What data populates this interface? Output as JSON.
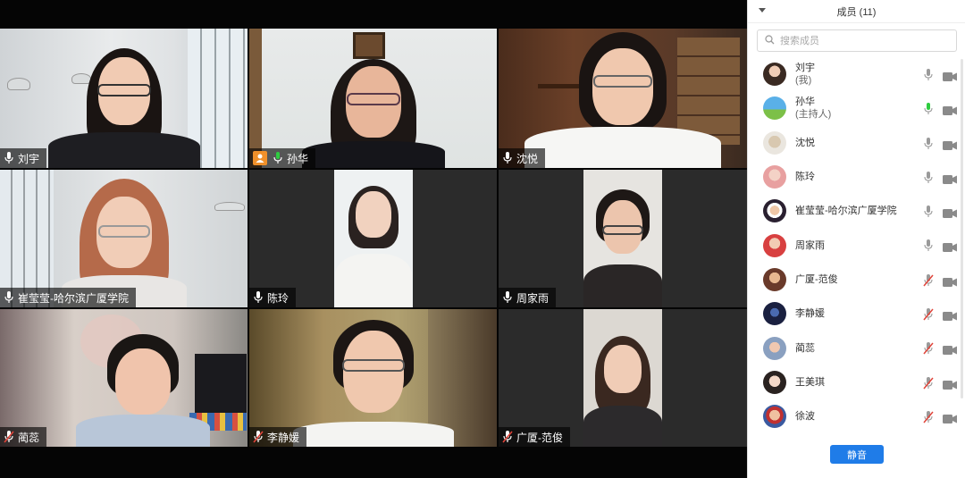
{
  "panel": {
    "title": "成员 (11)",
    "search": {
      "placeholder": "搜索成员",
      "value": ""
    },
    "mute_all_label": "静音",
    "members": [
      {
        "name": "刘宇",
        "sub": "(我)",
        "mic": "on",
        "avatar_icon": "user-photo-avatar-icon"
      },
      {
        "name": "孙华",
        "sub": "(主持人)",
        "mic": "speaking",
        "avatar_icon": "user-photo-avatar-icon"
      },
      {
        "name": "沈悦",
        "sub": "",
        "mic": "on",
        "avatar_icon": "user-photo-avatar-icon"
      },
      {
        "name": "陈玲",
        "sub": "",
        "mic": "on",
        "avatar_icon": "user-photo-avatar-icon"
      },
      {
        "name": "崔莹莹-哈尔滨广厦学院",
        "sub": "",
        "mic": "on",
        "avatar_icon": "user-photo-avatar-icon"
      },
      {
        "name": "周家雨",
        "sub": "",
        "mic": "on",
        "avatar_icon": "user-photo-avatar-icon"
      },
      {
        "name": "广厦-范俊",
        "sub": "",
        "mic": "muted",
        "avatar_icon": "user-photo-avatar-icon"
      },
      {
        "name": "李静媛",
        "sub": "",
        "mic": "muted",
        "avatar_icon": "user-photo-avatar-icon"
      },
      {
        "name": "蔺蕊",
        "sub": "",
        "mic": "muted",
        "avatar_icon": "user-photo-avatar-icon"
      },
      {
        "name": "王美琪",
        "sub": "",
        "mic": "muted",
        "avatar_icon": "user-photo-avatar-icon"
      },
      {
        "name": "徐波",
        "sub": "",
        "mic": "muted",
        "avatar_icon": "user-photo-avatar-icon"
      }
    ]
  },
  "tiles": [
    {
      "name": "刘宇",
      "mic": "on",
      "host": false,
      "active": false
    },
    {
      "name": "孙华",
      "mic": "speaking",
      "host": true,
      "active": true
    },
    {
      "name": "沈悦",
      "mic": "on",
      "host": false,
      "active": false
    },
    {
      "name": "崔莹莹-哈尔滨广厦学院",
      "mic": "on",
      "host": false,
      "active": false
    },
    {
      "name": "陈玲",
      "mic": "on",
      "host": false,
      "active": false
    },
    {
      "name": "周家雨",
      "mic": "on",
      "host": false,
      "active": false
    },
    {
      "name": "蔺蕊",
      "mic": "muted",
      "host": false,
      "active": false
    },
    {
      "name": "李静媛",
      "mic": "muted",
      "host": false,
      "active": false
    },
    {
      "name": "广厦-范俊",
      "mic": "muted",
      "host": false,
      "active": false
    }
  ],
  "colors": {
    "accent_blue": "#1f7ce8",
    "speaking_green": "#2ecc40",
    "muted_red": "#e0443a",
    "host_orange": "#f0902a"
  }
}
